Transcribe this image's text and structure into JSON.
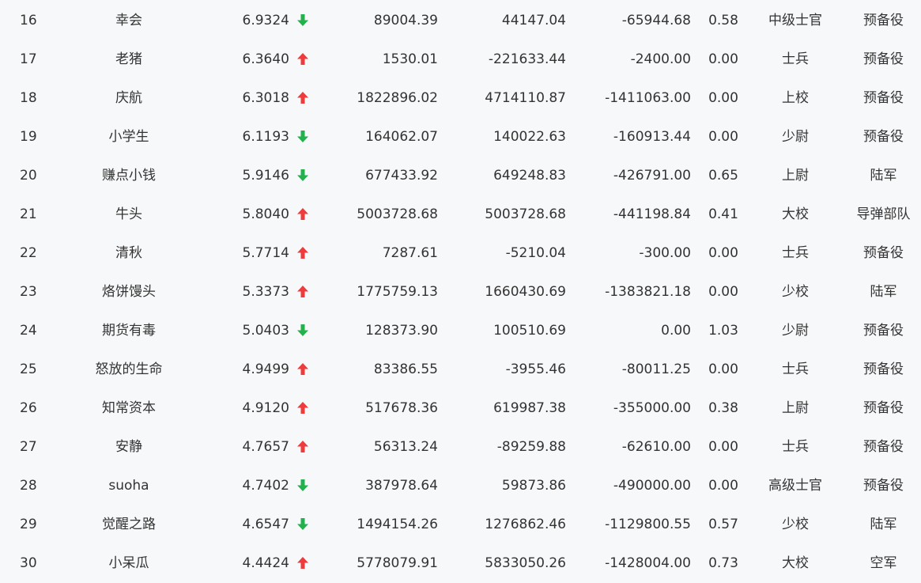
{
  "colors": {
    "background": "#f7f8fa",
    "text": "#333333",
    "up": "#ee3b3b",
    "down": "#22b14c"
  },
  "rows": [
    {
      "rank": "16",
      "name": "幸会",
      "score": "6.9324",
      "trend": "down",
      "trend_icon": "arrow-down-icon",
      "a": "89004.39",
      "b": "44147.04",
      "c": "-65944.68",
      "ratio": "0.58",
      "rank_title": "中级士官",
      "branch": "预备役"
    },
    {
      "rank": "17",
      "name": "老猪",
      "score": "6.3640",
      "trend": "up",
      "trend_icon": "arrow-up-icon",
      "a": "1530.01",
      "b": "-221633.44",
      "c": "-2400.00",
      "ratio": "0.00",
      "rank_title": "士兵",
      "branch": "预备役"
    },
    {
      "rank": "18",
      "name": "庆航",
      "score": "6.3018",
      "trend": "up",
      "trend_icon": "arrow-up-icon",
      "a": "1822896.02",
      "b": "4714110.87",
      "c": "-1411063.00",
      "ratio": "0.00",
      "rank_title": "上校",
      "branch": "预备役"
    },
    {
      "rank": "19",
      "name": "小学生",
      "score": "6.1193",
      "trend": "down",
      "trend_icon": "arrow-down-icon",
      "a": "164062.07",
      "b": "140022.63",
      "c": "-160913.44",
      "ratio": "0.00",
      "rank_title": "少尉",
      "branch": "预备役"
    },
    {
      "rank": "20",
      "name": "赚点小钱",
      "score": "5.9146",
      "trend": "down",
      "trend_icon": "arrow-down-icon",
      "a": "677433.92",
      "b": "649248.83",
      "c": "-426791.00",
      "ratio": "0.65",
      "rank_title": "上尉",
      "branch": "陆军"
    },
    {
      "rank": "21",
      "name": "牛头",
      "score": "5.8040",
      "trend": "up",
      "trend_icon": "arrow-up-icon",
      "a": "5003728.68",
      "b": "5003728.68",
      "c": "-441198.84",
      "ratio": "0.41",
      "rank_title": "大校",
      "branch": "导弹部队"
    },
    {
      "rank": "22",
      "name": "清秋",
      "score": "5.7714",
      "trend": "up",
      "trend_icon": "arrow-up-icon",
      "a": "7287.61",
      "b": "-5210.04",
      "c": "-300.00",
      "ratio": "0.00",
      "rank_title": "士兵",
      "branch": "预备役"
    },
    {
      "rank": "23",
      "name": "烙饼馒头",
      "score": "5.3373",
      "trend": "up",
      "trend_icon": "arrow-up-icon",
      "a": "1775759.13",
      "b": "1660430.69",
      "c": "-1383821.18",
      "ratio": "0.00",
      "rank_title": "少校",
      "branch": "陆军"
    },
    {
      "rank": "24",
      "name": "期货有毒",
      "score": "5.0403",
      "trend": "down",
      "trend_icon": "arrow-down-icon",
      "a": "128373.90",
      "b": "100510.69",
      "c": "0.00",
      "ratio": "1.03",
      "rank_title": "少尉",
      "branch": "预备役"
    },
    {
      "rank": "25",
      "name": "怒放的生命",
      "score": "4.9499",
      "trend": "up",
      "trend_icon": "arrow-up-icon",
      "a": "83386.55",
      "b": "-3955.46",
      "c": "-80011.25",
      "ratio": "0.00",
      "rank_title": "士兵",
      "branch": "预备役"
    },
    {
      "rank": "26",
      "name": "知常资本",
      "score": "4.9120",
      "trend": "up",
      "trend_icon": "arrow-up-icon",
      "a": "517678.36",
      "b": "619987.38",
      "c": "-355000.00",
      "ratio": "0.38",
      "rank_title": "上尉",
      "branch": "预备役"
    },
    {
      "rank": "27",
      "name": "安静",
      "score": "4.7657",
      "trend": "up",
      "trend_icon": "arrow-up-icon",
      "a": "56313.24",
      "b": "-89259.88",
      "c": "-62610.00",
      "ratio": "0.00",
      "rank_title": "士兵",
      "branch": "预备役"
    },
    {
      "rank": "28",
      "name": "suoha",
      "score": "4.7402",
      "trend": "down",
      "trend_icon": "arrow-down-icon",
      "a": "387978.64",
      "b": "59873.86",
      "c": "-490000.00",
      "ratio": "0.00",
      "rank_title": "高级士官",
      "branch": "预备役"
    },
    {
      "rank": "29",
      "name": "觉醒之路",
      "score": "4.6547",
      "trend": "down",
      "trend_icon": "arrow-down-icon",
      "a": "1494154.26",
      "b": "1276862.46",
      "c": "-1129800.55",
      "ratio": "0.57",
      "rank_title": "少校",
      "branch": "陆军"
    },
    {
      "rank": "30",
      "name": "小呆瓜",
      "score": "4.4424",
      "trend": "up",
      "trend_icon": "arrow-up-icon",
      "a": "5778079.91",
      "b": "5833050.26",
      "c": "-1428004.00",
      "ratio": "0.73",
      "rank_title": "大校",
      "branch": "空军"
    }
  ]
}
